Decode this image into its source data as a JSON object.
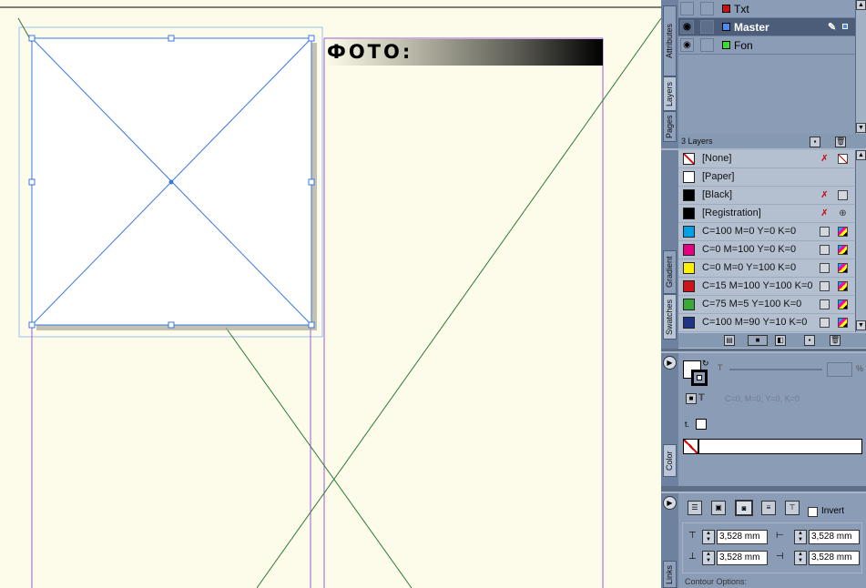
{
  "document": {
    "photo_label": "ФОТО:"
  },
  "layers_panel": {
    "tabs": [
      "Attributes",
      "Layers",
      "Pages"
    ],
    "layers": [
      {
        "name": "Txt",
        "color": "#cc1111",
        "visible": false,
        "selected": false
      },
      {
        "name": "Master",
        "color": "#4b8cf0",
        "visible": true,
        "selected": true
      },
      {
        "name": "Fon",
        "color": "#33dd33",
        "visible": true,
        "selected": false
      }
    ],
    "footer": "3 Layers"
  },
  "swatches_panel": {
    "tabs": [
      "Gradient",
      "Swatches"
    ],
    "swatches": [
      {
        "name": "[None]",
        "color": "none"
      },
      {
        "name": "[Paper]",
        "color": "#ffffff"
      },
      {
        "name": "[Black]",
        "color": "#000000"
      },
      {
        "name": "[Registration]",
        "color": "#000000"
      },
      {
        "name": "C=100 M=0 Y=0 K=0",
        "color": "#00a0e8"
      },
      {
        "name": "C=0 M=100 Y=0 K=0",
        "color": "#e4007f"
      },
      {
        "name": "C=0 M=0 Y=100 K=0",
        "color": "#fff000"
      },
      {
        "name": "C=15 M=100 Y=100 K=0",
        "color": "#d0121b"
      },
      {
        "name": "C=75 M=5 Y=100 K=0",
        "color": "#3aa935"
      },
      {
        "name": "C=100 M=90 Y=10 K=0",
        "color": "#1f3486"
      }
    ]
  },
  "color_panel": {
    "tab": "Color",
    "tint_label": "T",
    "percent": "%",
    "cmyk_text": "C=0, M=0, Y=0, K=0",
    "text_label": "t."
  },
  "wrap_panel": {
    "tab": "Links",
    "invert_label": "Invert",
    "top_offset": "3,528 mm",
    "left_offset": "3,528 mm",
    "bottom_offset": "3,528 mm",
    "right_offset": "3,528 mm",
    "contour_label": "Contour Options:"
  }
}
